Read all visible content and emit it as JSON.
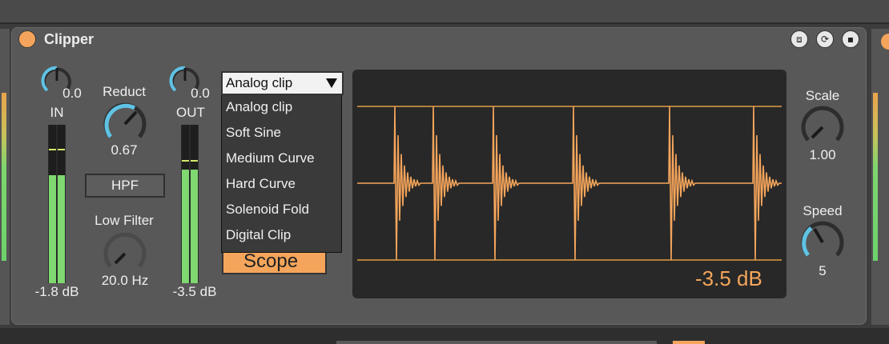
{
  "device": {
    "title": "Clipper",
    "power_color": "#f5a55b",
    "accent_color": "#f5a55b",
    "title_buttons": [
      "freeze-icon",
      "refresh-icon",
      "save-icon"
    ]
  },
  "in_section": {
    "knob_value": "0.0",
    "label": "IN",
    "meter_value": "-1.8 dB"
  },
  "reduct": {
    "label": "Reduct",
    "value": "0.67"
  },
  "hpf": {
    "label": "HPF"
  },
  "low_filter": {
    "label": "Low Filter",
    "value": "20.0 Hz"
  },
  "out_section": {
    "knob_value": "0.0",
    "label": "OUT",
    "meter_value": "-3.5 dB"
  },
  "clip_mode": {
    "selected": "Analog clip",
    "options": [
      "Analog clip",
      "Soft Sine",
      "Medium Curve",
      "Hard Curve",
      "Solenoid Fold",
      "Digital Clip"
    ]
  },
  "scope_button": {
    "label": "Scope"
  },
  "scope_display": {
    "readout": "-3.5 dB",
    "waveform_color": "#f5a55b"
  },
  "scale": {
    "label": "Scale",
    "value": "1.00"
  },
  "speed": {
    "label": "Speed",
    "value": "5"
  }
}
